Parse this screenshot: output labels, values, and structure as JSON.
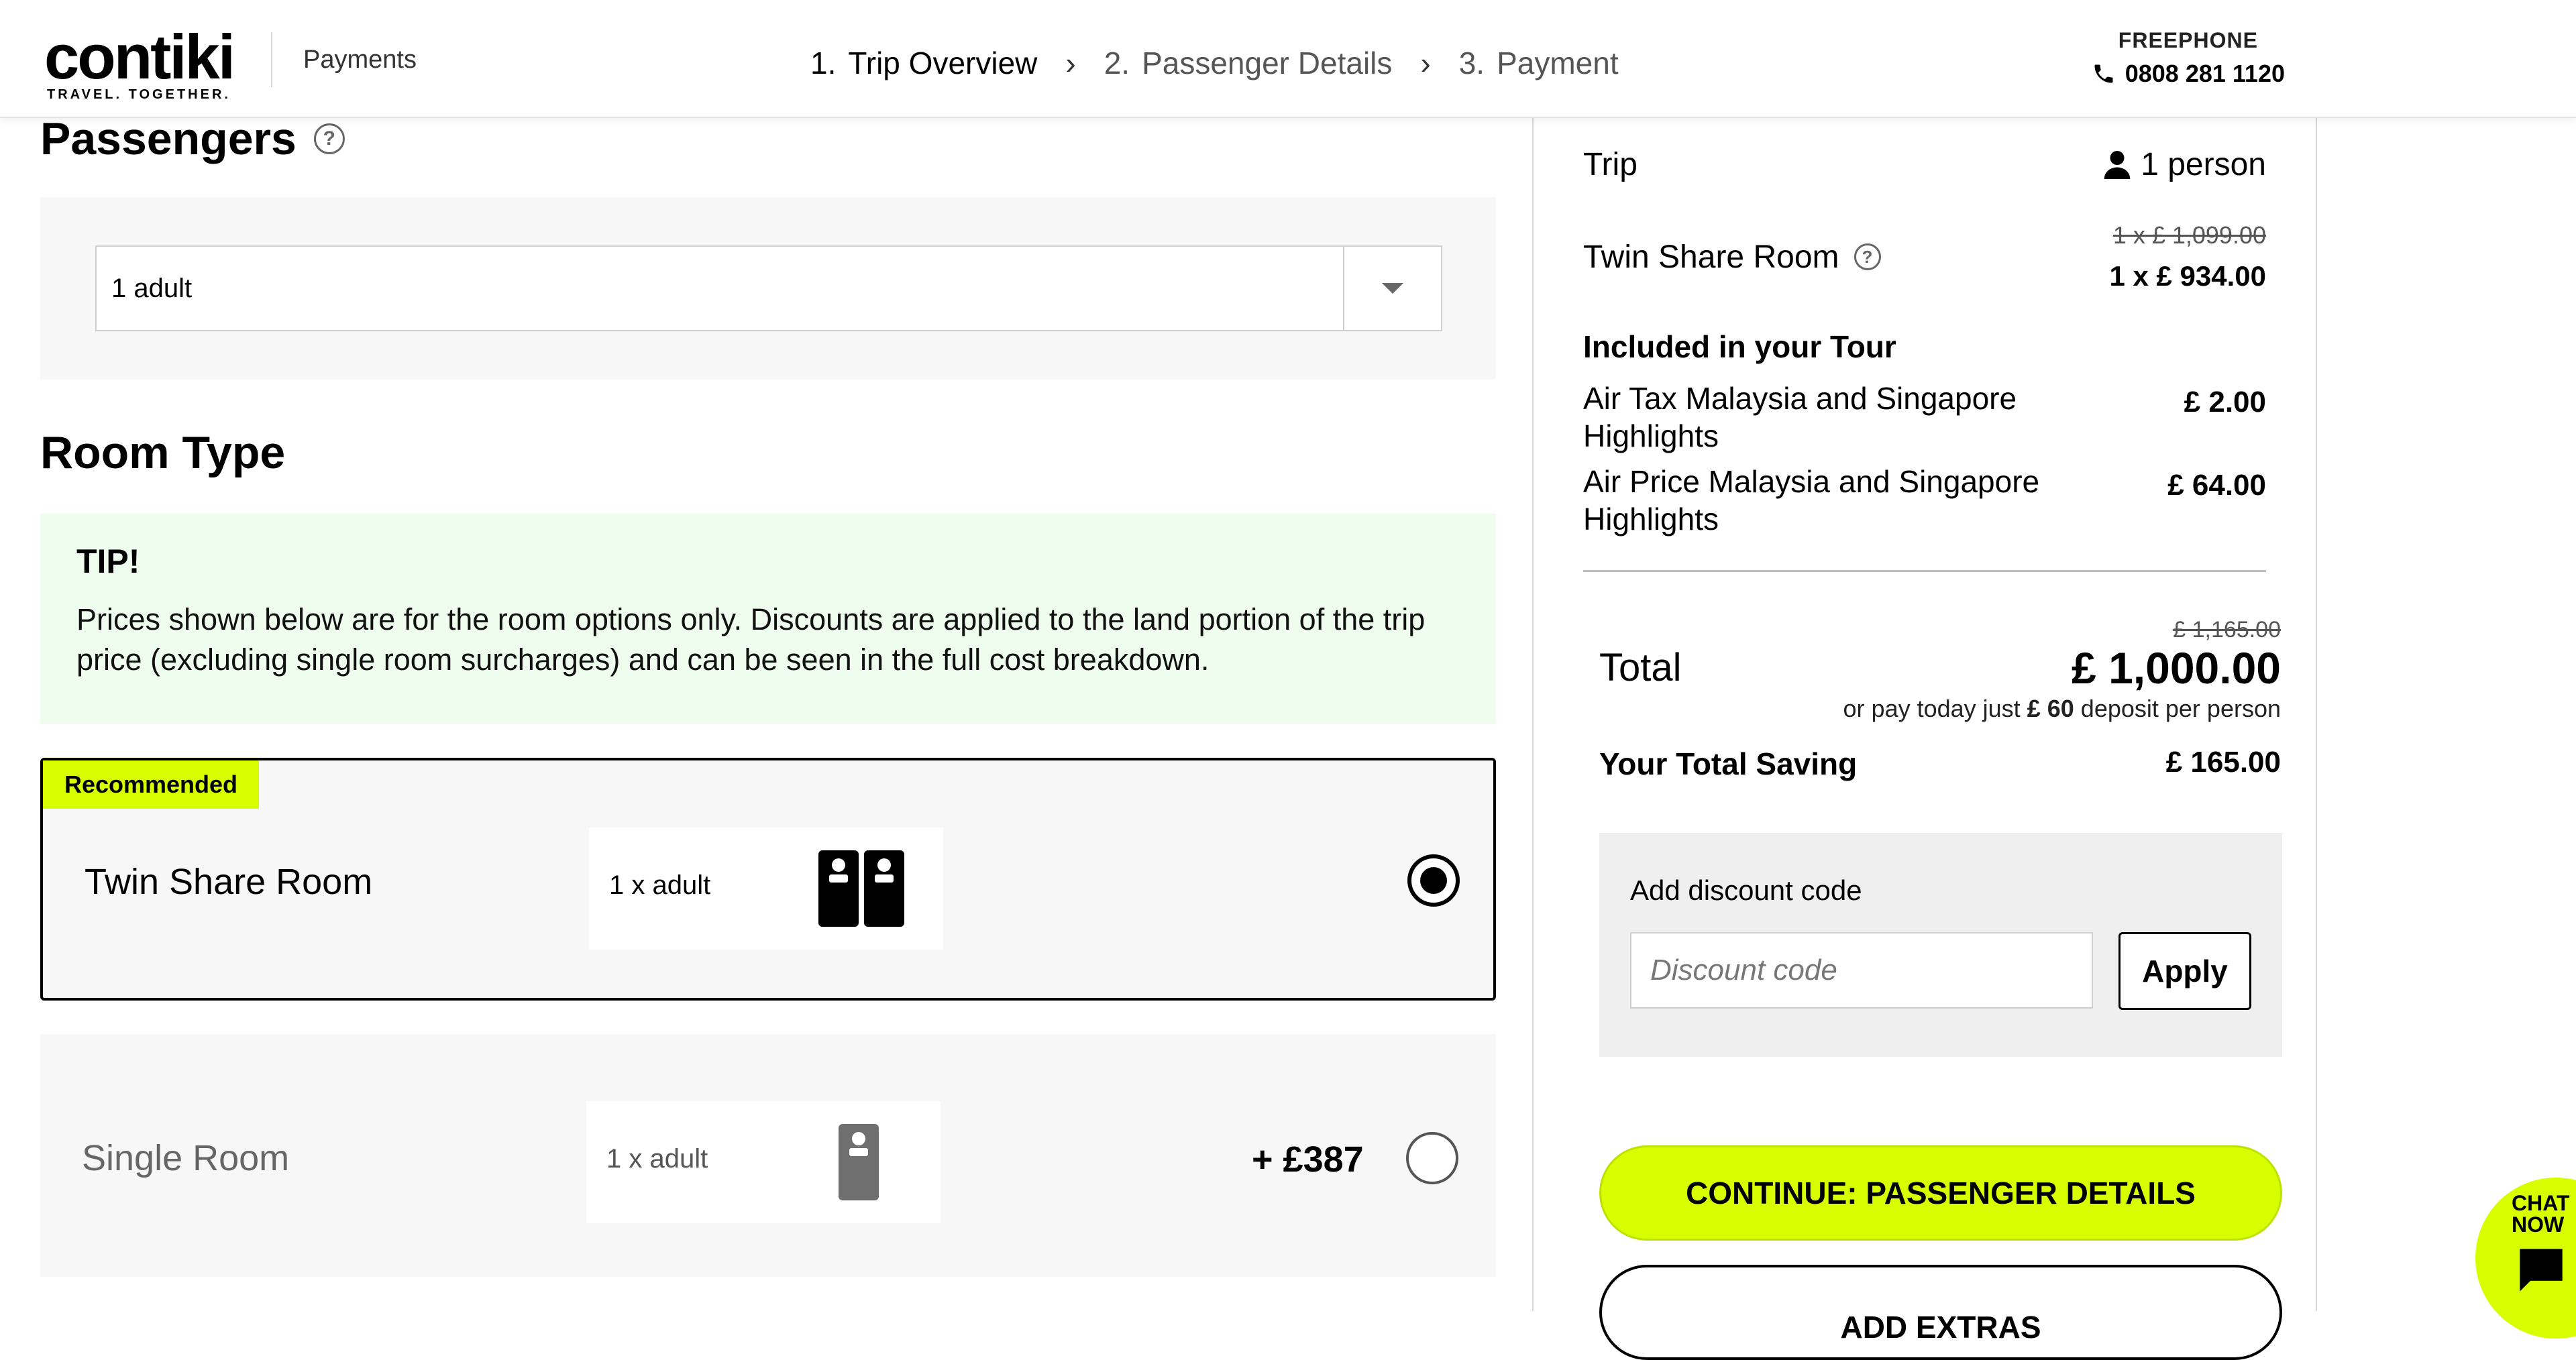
{
  "header": {
    "logo_word": "contiki",
    "logo_tagline": "TRAVEL. TOGETHER.",
    "section": "Payments",
    "steps": [
      {
        "num": "1.",
        "label": "Trip Overview",
        "active": true
      },
      {
        "num": "2.",
        "label": "Passenger Details",
        "active": false
      },
      {
        "num": "3.",
        "label": "Payment",
        "active": false
      }
    ],
    "phone_label": "FREEPHONE",
    "phone_number": "0808 281 1120"
  },
  "passengers": {
    "heading": "Passengers",
    "selected": "1 adult"
  },
  "room_type": {
    "heading": "Room Type",
    "tip_title": "TIP!",
    "tip_text": "Prices shown below are for the room options only. Discounts are applied to the land portion of the trip price (excluding single room surcharges) and can be seen in the full cost breakdown.",
    "options": [
      {
        "badge": "Recommended",
        "name": "Twin Share Room",
        "occupancy": "1 x adult",
        "price": "",
        "selected": true,
        "icon": "twin-beds-icon"
      },
      {
        "badge": "",
        "name": "Single Room",
        "occupancy": "1 x adult",
        "price": "+ £387",
        "selected": false,
        "icon": "single-bed-icon"
      }
    ]
  },
  "summary": {
    "trip_label": "Trip",
    "trip_people": "1 person",
    "room_label": "Twin Share Room",
    "room_price_old": "1 x £ 1,099.00",
    "room_price_new": "1 x £ 934.00",
    "included_title": "Included in your Tour",
    "included": [
      {
        "name": "Air Tax Malaysia and Singapore Highlights",
        "price": "£ 2.00"
      },
      {
        "name": "Air Price Malaysia and Singapore Highlights",
        "price": "£ 64.00"
      }
    ],
    "total_old": "£ 1,165.00",
    "total_label": "Total",
    "total_value": "£ 1,000.00",
    "deposit_prefix": "or pay today just",
    "deposit_amount": "£ 60",
    "deposit_suffix": "deposit per person",
    "saving_label": "Your Total Saving",
    "saving_value": "£ 165.00",
    "discount_label": "Add discount code",
    "discount_placeholder": "Discount code",
    "apply_label": "Apply",
    "continue_label": "CONTINUE: PASSENGER DETAILS",
    "extras_label": "ADD EXTRAS"
  },
  "chat": {
    "line1": "CHAT",
    "line2": "NOW"
  },
  "colors": {
    "accent": "#d7ff00",
    "tip_bg": "#effdef",
    "panel_bg": "#f7f7f7"
  }
}
